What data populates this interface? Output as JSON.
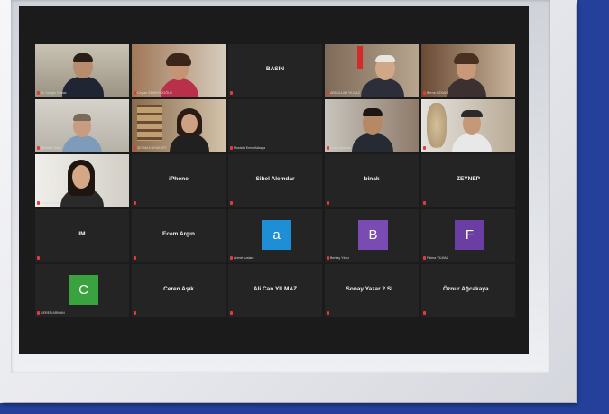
{
  "meeting": {
    "participants": [
      {
        "kind": "video",
        "caption": "Dr. Cengiz Yılmaz"
      },
      {
        "kind": "video",
        "caption": "Ceylan SEMERCİOĞLU"
      },
      {
        "kind": "name",
        "name": "BASIN"
      },
      {
        "kind": "video",
        "caption": "ABDULLAH YILMAZ"
      },
      {
        "kind": "video",
        "caption": "Berna ÖZKAN"
      },
      {
        "kind": "video",
        "caption": "Mehmet Yıldız"
      },
      {
        "kind": "video",
        "caption": "ŞEYMA KARAKURT"
      },
      {
        "kind": "name",
        "caption": "Mustafa Emre Akkaya"
      },
      {
        "kind": "video",
        "caption": "Ozan Karahan"
      },
      {
        "kind": "video",
        "caption": "Kübra YILDIZ"
      },
      {
        "kind": "video",
        "caption": "Duygu Yıldız"
      },
      {
        "kind": "name",
        "name": "iPhone"
      },
      {
        "kind": "name",
        "name": "Sibel Alemdar"
      },
      {
        "kind": "name",
        "name": "binak"
      },
      {
        "kind": "name",
        "name": "ZEYNEP"
      },
      {
        "kind": "name",
        "name": "IM"
      },
      {
        "kind": "name",
        "name": "Ecem Argın"
      },
      {
        "kind": "avatar",
        "letter": "a",
        "color": "#1e8ed6",
        "caption": "Ahmet Arslan"
      },
      {
        "kind": "avatar",
        "letter": "B",
        "color": "#7a4bb2",
        "caption": "Berkay Yıldız"
      },
      {
        "kind": "avatar",
        "letter": "F",
        "color": "#6a3ea3",
        "caption": "Fatma YILMAZ"
      },
      {
        "kind": "avatar",
        "letter": "C",
        "color": "#3aa23f",
        "caption": "CEREN ARIKAN"
      },
      {
        "kind": "name",
        "name": "Ceren Aşık"
      },
      {
        "kind": "name",
        "name": "Ali Can YILMAZ"
      },
      {
        "kind": "name",
        "name": "Sonay Yazar 2.Sl..."
      },
      {
        "kind": "name",
        "name": "Öznur Ağcakaya..."
      }
    ]
  }
}
